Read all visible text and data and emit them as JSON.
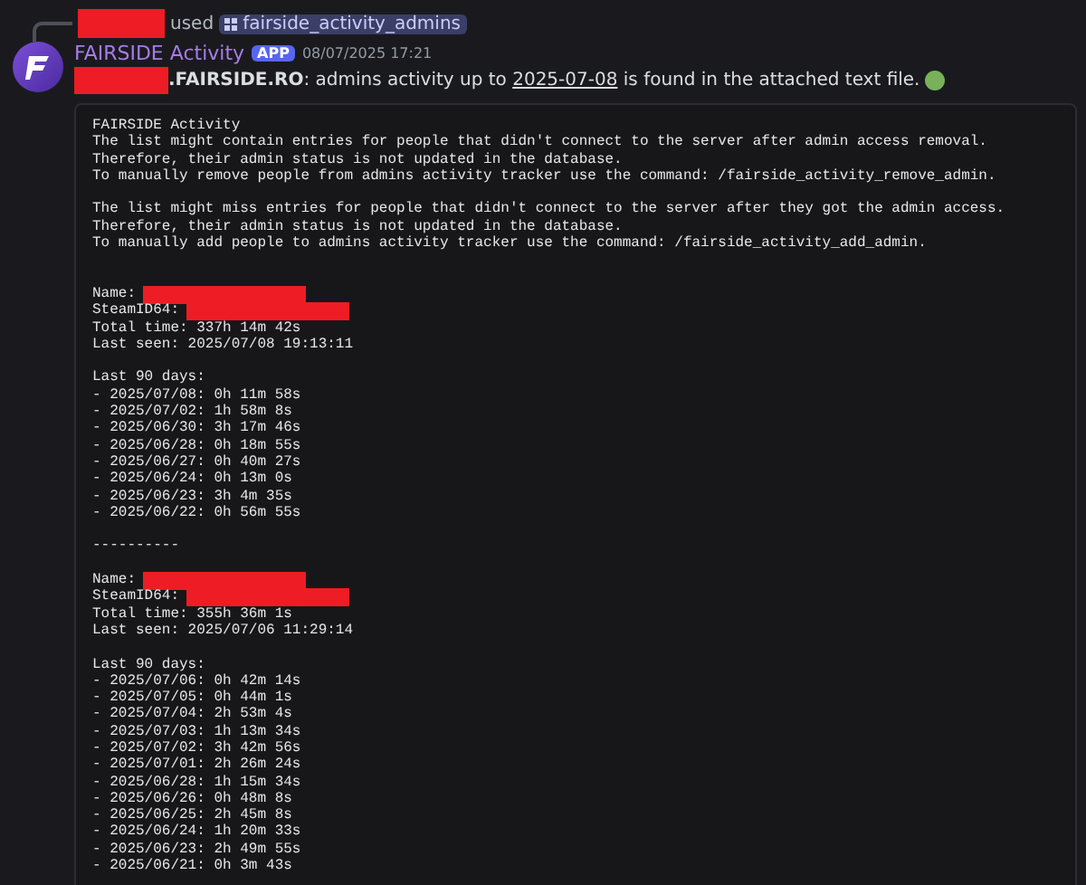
{
  "reply": {
    "used": "used",
    "command": "fairside_activity_admins"
  },
  "message": {
    "author": "FAIRSIDE Activity",
    "badge": "APP",
    "timestamp": "08/07/2025 17:21",
    "before": "**.FAIRSIDE.RO**: admins activity up to ",
    "date": "2025-07-08",
    "after": " is found in the attached text file."
  },
  "attachment": {
    "lines": [
      {
        "kind": "text",
        "text": "FAIRSIDE Activity"
      },
      {
        "kind": "text",
        "text": "The list might contain entries for people that didn't connect to the server after admin access removal."
      },
      {
        "kind": "text",
        "text": "Therefore, their admin status is not updated in the database."
      },
      {
        "kind": "text",
        "text": "To manually remove people from admins activity tracker use the command: /fairside_activity_remove_admin."
      },
      {
        "kind": "blank"
      },
      {
        "kind": "text",
        "text": "The list might miss entries for people that didn't connect to the server after they got the admin access."
      },
      {
        "kind": "text",
        "text": "Therefore, their admin status is not updated in the database."
      },
      {
        "kind": "text",
        "text": "To manually add people to admins activity tracker use the command: /fairside_activity_add_admin."
      },
      {
        "kind": "blank"
      },
      {
        "kind": "blank"
      },
      {
        "kind": "field",
        "text": "Name:"
      },
      {
        "kind": "field",
        "text": "SteamID64:"
      },
      {
        "kind": "text",
        "text": "Total time: 337h 14m 42s"
      },
      {
        "kind": "text",
        "text": "Last seen: 2025/07/08 19:13:11"
      },
      {
        "kind": "blank"
      },
      {
        "kind": "text",
        "text": "Last 90 days:"
      },
      {
        "kind": "text",
        "text": "- 2025/07/08: 0h 11m 58s"
      },
      {
        "kind": "text",
        "text": "- 2025/07/02: 1h 58m 8s"
      },
      {
        "kind": "text",
        "text": "- 2025/06/30: 3h 17m 46s"
      },
      {
        "kind": "text",
        "text": "- 2025/06/28: 0h 18m 55s"
      },
      {
        "kind": "text",
        "text": "- 2025/06/27: 0h 40m 27s"
      },
      {
        "kind": "text",
        "text": "- 2025/06/24: 0h 13m 0s"
      },
      {
        "kind": "text",
        "text": "- 2025/06/23: 3h 4m 35s"
      },
      {
        "kind": "text",
        "text": "- 2025/06/22: 0h 56m 55s"
      },
      {
        "kind": "blank"
      },
      {
        "kind": "text",
        "text": "----------"
      },
      {
        "kind": "blank"
      },
      {
        "kind": "field",
        "text": "Name:"
      },
      {
        "kind": "field",
        "text": "SteamID64:"
      },
      {
        "kind": "text",
        "text": "Total time: 355h 36m 1s"
      },
      {
        "kind": "text",
        "text": "Last seen: 2025/07/06 11:29:14"
      },
      {
        "kind": "blank"
      },
      {
        "kind": "text",
        "text": "Last 90 days:"
      },
      {
        "kind": "text",
        "text": "- 2025/07/06: 0h 42m 14s"
      },
      {
        "kind": "text",
        "text": "- 2025/07/05: 0h 44m 1s"
      },
      {
        "kind": "text",
        "text": "- 2025/07/04: 2h 53m 4s"
      },
      {
        "kind": "text",
        "text": "- 2025/07/03: 1h 13m 34s"
      },
      {
        "kind": "text",
        "text": "- 2025/07/02: 3h 42m 56s"
      },
      {
        "kind": "text",
        "text": "- 2025/07/01: 2h 26m 24s"
      },
      {
        "kind": "text",
        "text": "- 2025/06/28: 1h 15m 34s"
      },
      {
        "kind": "text",
        "text": "- 2025/06/26: 0h 48m 8s"
      },
      {
        "kind": "text",
        "text": "- 2025/06/25: 2h 45m 8s"
      },
      {
        "kind": "text",
        "text": "- 2025/06/24: 1h 20m 33s"
      },
      {
        "kind": "text",
        "text": "- 2025/06/23: 2h 49m 55s"
      },
      {
        "kind": "text",
        "text": "- 2025/06/21: 0h 3m 43s"
      }
    ]
  }
}
